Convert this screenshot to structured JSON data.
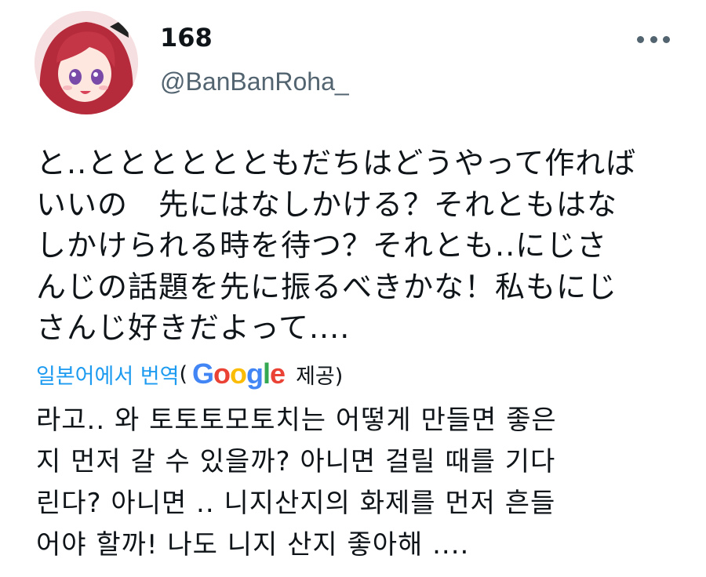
{
  "author": {
    "display_name": "168",
    "handle": "@BanBanRoha_"
  },
  "menu": {
    "icon": "more-horizontal-icon"
  },
  "tweet": {
    "text": "と..とととととともだちはどうやって作れば\nいいの　先にはなしかける？それともはな\nしかけられる時を待つ？それとも..にじさ\nんじの話題を先に振るべきかな！私もにじ\nさんじ好きだよって...."
  },
  "translation": {
    "link_label": "일본어에서 번역",
    "open_paren": "(",
    "provider_letters": [
      "G",
      "o",
      "o",
      "g",
      "l",
      "e"
    ],
    "provided_label": "제공)",
    "text": "라고.. 와 토토토모토치는 어떻게 만들면 좋은\n지 먼저 갈 수 있을까? 아니면 걸릴 때를 기다\n린다? 아니면 .. 니지산지의 화제를 먼저 흔들\n어야 할까! 나도 니지 산지 좋아해 ...."
  },
  "colors": {
    "link": "#1d9bf0",
    "secondary_text": "#536471",
    "google_blue": "#4285f4",
    "google_red": "#ea4335",
    "google_yellow": "#fbbc05",
    "google_green": "#34a853"
  }
}
